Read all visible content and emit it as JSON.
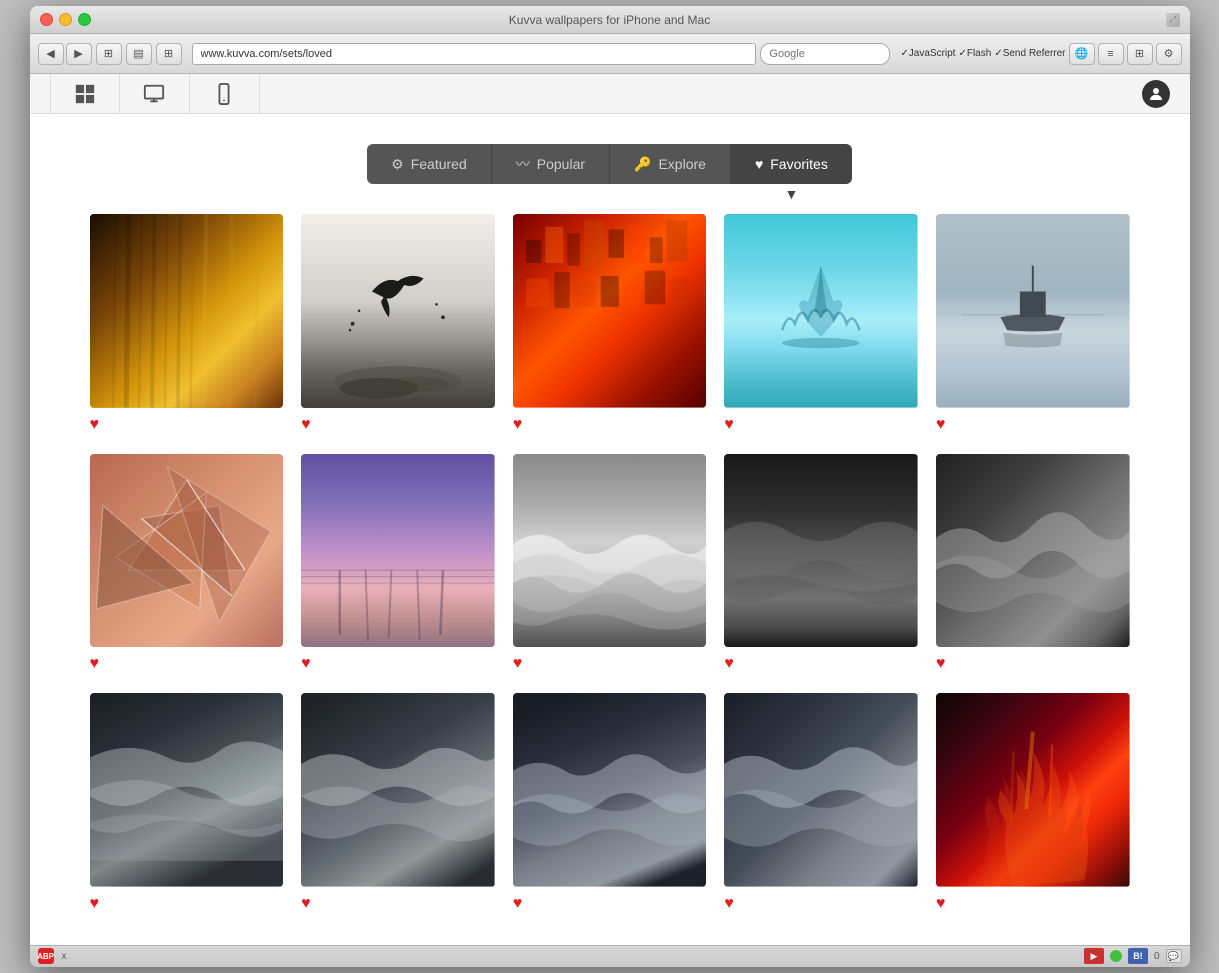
{
  "browser": {
    "title": "Kuvva wallpapers for iPhone and Mac",
    "url": "www.kuvva.com/sets/loved",
    "search_placeholder": "Google",
    "checkboxes": [
      "JavaScript",
      "Flash",
      "Send Referrer"
    ]
  },
  "nav": {
    "icons": [
      "grid",
      "monitor",
      "phone"
    ],
    "user_label": "user"
  },
  "tabs": [
    {
      "id": "featured",
      "label": "Featured",
      "icon": "⚙",
      "active": false
    },
    {
      "id": "popular",
      "label": "Popular",
      "icon": "∿",
      "active": false
    },
    {
      "id": "explore",
      "label": "Explore",
      "icon": "🔧",
      "active": false
    },
    {
      "id": "favorites",
      "label": "Favorites",
      "icon": "♥",
      "active": true
    }
  ],
  "images": [
    {
      "id": 1,
      "theme": "warm-blur",
      "liked": true
    },
    {
      "id": 2,
      "theme": "bird-bw",
      "liked": true
    },
    {
      "id": 3,
      "theme": "city-red",
      "liked": true
    },
    {
      "id": 4,
      "theme": "water-drop",
      "liked": true
    },
    {
      "id": 5,
      "theme": "foggy-boat",
      "liked": true
    },
    {
      "id": 6,
      "theme": "geo-purple",
      "liked": true
    },
    {
      "id": 7,
      "theme": "purple-sunset",
      "liked": true
    },
    {
      "id": 8,
      "theme": "waves1",
      "liked": true
    },
    {
      "id": 9,
      "theme": "waves2",
      "liked": true
    },
    {
      "id": 10,
      "theme": "waves3",
      "liked": true
    },
    {
      "id": 11,
      "theme": "stormy1",
      "liked": true
    },
    {
      "id": 12,
      "theme": "stormy2",
      "liked": true
    },
    {
      "id": 13,
      "theme": "stormy3",
      "liked": true
    },
    {
      "id": 14,
      "theme": "stormy4",
      "liked": true
    },
    {
      "id": 15,
      "theme": "red-fire",
      "liked": true
    }
  ],
  "heart_char": "♥",
  "status": {
    "close_label": "x",
    "count": "0",
    "flag_color": "#4060b0"
  }
}
